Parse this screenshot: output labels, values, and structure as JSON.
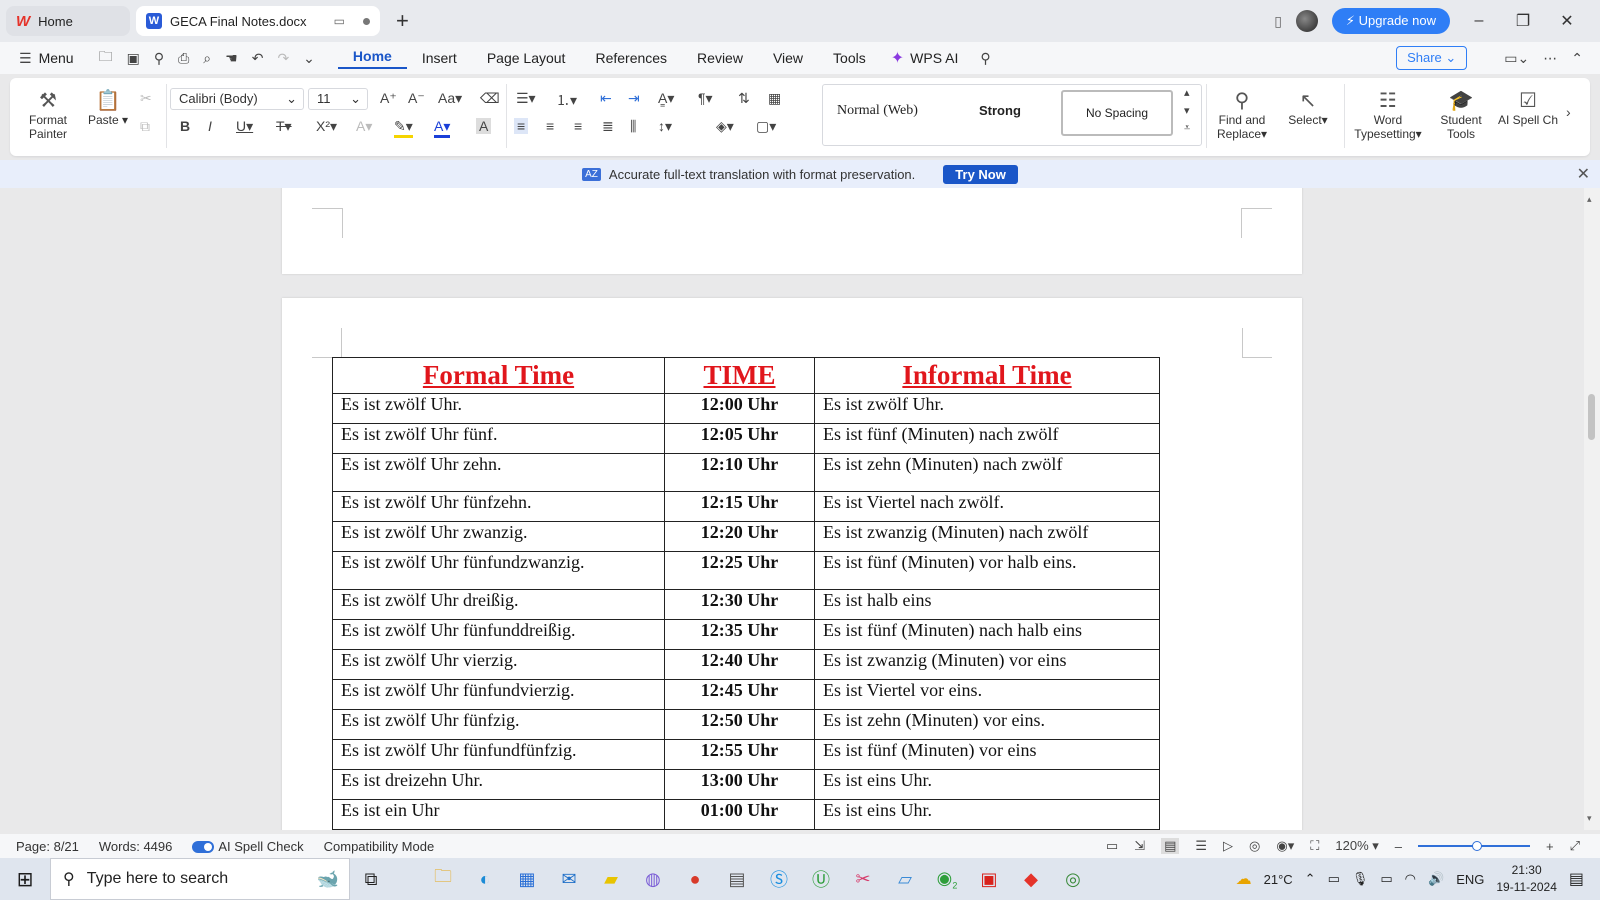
{
  "tabs": {
    "home_label": "Home",
    "doc_label": "GECA Final Notes.docx"
  },
  "titlebar": {
    "upgrade_label": "Upgrade now"
  },
  "menu": {
    "menu_label": "Menu",
    "items": [
      "Home",
      "Insert",
      "Page Layout",
      "References",
      "Review",
      "View",
      "Tools"
    ],
    "wps_ai": "WPS AI",
    "share": "Share"
  },
  "ribbon": {
    "format_painter": "Format\nPainter",
    "format_painter_1": "Format",
    "format_painter_2": "Painter",
    "paste": "Paste",
    "font_name": "Calibri (Body)",
    "font_size": "11",
    "styles": [
      "Normal (Web)",
      "Strong",
      "No Spacing"
    ],
    "find_replace_1": "Find and",
    "find_replace_2": "Replace",
    "select": "Select",
    "word_type_1": "Word",
    "word_type_2": "Typesetting",
    "student_1": "Student",
    "student_2": "Tools",
    "ai_spell": "AI Spell Ch"
  },
  "notification": {
    "text": "Accurate full-text translation with format preservation.",
    "button": "Try Now"
  },
  "table": {
    "headers": [
      "Formal Time",
      "TIME",
      "Informal Time"
    ],
    "rows": [
      [
        "Es ist zwölf Uhr.",
        "12:00 Uhr",
        "Es ist zwölf Uhr."
      ],
      [
        "Es ist zwölf Uhr fünf.",
        "12:05 Uhr",
        "Es ist fünf (Minuten) nach zwölf"
      ],
      [
        "Es ist zwölf Uhr zehn.",
        "12:10 Uhr",
        "Es ist zehn (Minuten) nach zwölf"
      ],
      [
        "Es ist zwölf Uhr fünfzehn.",
        "12:15 Uhr",
        "Es ist Viertel nach zwölf."
      ],
      [
        "Es ist zwölf Uhr zwanzig.",
        "12:20 Uhr",
        "Es ist zwanzig (Minuten) nach zwölf"
      ],
      [
        "Es ist zwölf Uhr fünfundzwanzig.",
        "12:25 Uhr",
        "Es ist fünf (Minuten) vor halb eins."
      ],
      [
        "Es ist zwölf Uhr dreißig.",
        "12:30 Uhr",
        "Es ist halb eins"
      ],
      [
        "Es ist zwölf Uhr fünfunddreißig.",
        "12:35 Uhr",
        "Es ist fünf (Minuten) nach halb eins"
      ],
      [
        "Es ist zwölf Uhr vierzig.",
        "12:40 Uhr",
        "Es ist zwanzig (Minuten) vor eins"
      ],
      [
        "Es ist zwölf Uhr fünfundvierzig.",
        "12:45 Uhr",
        "Es ist Viertel vor eins."
      ],
      [
        "Es ist zwölf Uhr fünfzig.",
        "12:50 Uhr",
        "Es ist zehn (Minuten) vor eins."
      ],
      [
        "Es ist zwölf Uhr fünfundfünfzig.",
        "12:55 Uhr",
        "Es ist fünf (Minuten) vor eins"
      ],
      [
        "Es ist dreizehn Uhr.",
        "13:00 Uhr",
        "Es ist eins Uhr."
      ],
      [
        "Es ist ein Uhr",
        "01:00 Uhr",
        "Es ist eins Uhr."
      ]
    ]
  },
  "status": {
    "page": "Page: 8/21",
    "words": "Words: 4496",
    "ai_spell": "AI Spell Check",
    "compat": "Compatibility Mode",
    "zoom": "120%"
  },
  "taskbar": {
    "search_placeholder": "Type here to search",
    "weather": "21°C",
    "lang": "ENG",
    "time": "21:30",
    "date": "19-11-2024",
    "badge": "2"
  },
  "colors": {
    "accent": "#1a56c8",
    "header_red": "#e1161c",
    "upgrade_blue": "#2f7ef6"
  }
}
